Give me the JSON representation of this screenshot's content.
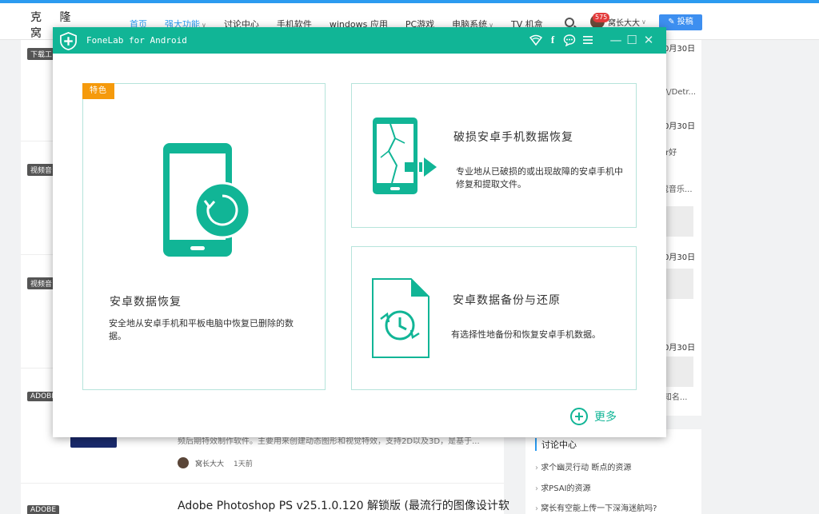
{
  "site": {
    "logo_text": "克 隆 窝",
    "nav": [
      {
        "label": "首页",
        "state": "active"
      },
      {
        "label": "强大功能",
        "state": "accent",
        "dropdown": true
      },
      {
        "label": "讨论中心",
        "state": "normal"
      },
      {
        "label": "手机软件",
        "state": "normal"
      },
      {
        "label": "windows 应用",
        "state": "normal"
      },
      {
        "label": "PC游戏",
        "state": "normal"
      },
      {
        "label": "电脑系统",
        "state": "normal",
        "dropdown": true
      },
      {
        "label": "TV 机盒",
        "state": "normal"
      }
    ],
    "notification_count": "575",
    "user_name": "窝长大大",
    "post_button": "投稿"
  },
  "background": {
    "tags": [
      "下载工",
      "视频音",
      "视频音",
      "ADOBE",
      "ADOBE"
    ],
    "article_desc": "频后期特效制作软件。主要用来创建动态图形和视觉特效，支持2D以及3D，是基于...",
    "author": "窝长大大",
    "time_ago": "1天前",
    "article_title": "Adobe Photoshop PS v25.1.0.120 解锁版 (最流行的图像设计软",
    "side_dates": [
      "0月30日",
      "0月30日",
      "0月30日",
      "0月30日"
    ],
    "side_fragments": [
      "A\\/Detr...",
      "er好",
      "蔻音乐...",
      "(知名..."
    ],
    "side_heading": "讨论中心",
    "side_links": [
      "求个幽灵行动 断点的资源",
      "求PSAI的资源",
      "窝长有空能上传一下深海迷航吗?"
    ]
  },
  "dialog": {
    "title": "FoneLab for Android",
    "feature_badge": "特色",
    "cards": {
      "recovery": {
        "title": "安卓数据恢复",
        "desc": "安全地从安卓手机和平板电脑中恢复已删除的数据。"
      },
      "broken": {
        "title": "破损安卓手机数据恢复",
        "desc": "专业地从已破损的或出现故障的安卓手机中修复和提取文件。"
      },
      "backup": {
        "title": "安卓数据备份与还原",
        "desc": "有选择性地备份和恢复安卓手机数据。"
      }
    },
    "more_label": "更多",
    "colors": {
      "teal": "#11b596",
      "ribbon": "#f59a0c",
      "card_border": "#b6e4db"
    }
  }
}
